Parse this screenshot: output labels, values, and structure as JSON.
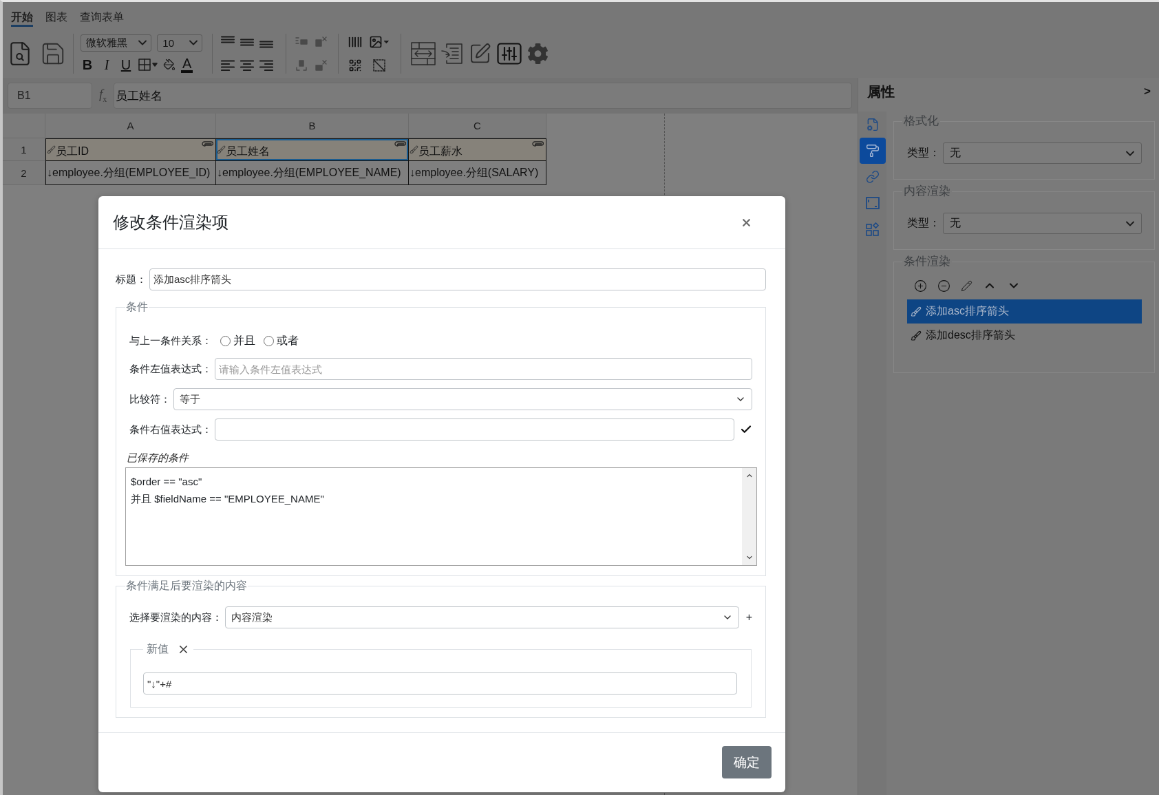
{
  "menu_tabs": [
    {
      "label": "开始",
      "selected": true
    },
    {
      "label": "图表",
      "selected": false
    },
    {
      "label": "查询表单",
      "selected": false
    }
  ],
  "toolbar": {
    "font_family": "微软雅黑",
    "font_size": "10",
    "style_buttons": [
      {
        "kind": "bold",
        "label": "B"
      },
      {
        "kind": "italic",
        "label": "I"
      },
      {
        "kind": "underline",
        "label": "U"
      }
    ],
    "font_color": {
      "label": "A"
    }
  },
  "formula_bar": {
    "cell_ref": "B1",
    "fx": "f$_{x}$",
    "value": "员工姓名"
  },
  "sheet": {
    "columns": [
      "A",
      "B",
      "C"
    ],
    "rows": [
      {
        "number": "1",
        "kind": "header",
        "cells": [
          {
            "text": "员工ID",
            "selected": false
          },
          {
            "text": "员工姓名",
            "selected": true
          },
          {
            "text": "员工薪水",
            "selected": false
          }
        ]
      },
      {
        "number": "2",
        "kind": "data",
        "cells": [
          {
            "text": "↓employee.分组(EMPLOYEE_ID)",
            "selected": false
          },
          {
            "text": "↓employee.分组(EMPLOYEE_NAME)",
            "selected": false
          },
          {
            "text": "↓employee.分组(SALARY)",
            "selected": false
          }
        ]
      }
    ]
  },
  "properties": {
    "title": "属性",
    "toggle": ">",
    "side_tabs": [
      {
        "selected": false
      },
      {
        "selected": true
      },
      {
        "selected": false
      },
      {
        "selected": false
      },
      {
        "selected": false
      }
    ],
    "sections": [
      {
        "kind": "select",
        "legend": "格式化",
        "label": "类型：",
        "value": "无"
      },
      {
        "kind": "select",
        "legend": "内容渲染",
        "label": "类型：",
        "value": "无"
      },
      {
        "kind": "list",
        "legend": "条件渲染",
        "items": [
          {
            "label": "添加asc排序箭头",
            "selected": true
          },
          {
            "label": "添加desc排序箭头",
            "selected": false
          }
        ]
      }
    ]
  },
  "dialog": {
    "title": "修改条件渲染项",
    "title_field": {
      "label": "标题：",
      "value": "添加asc排序箭头"
    },
    "condition": {
      "legend": "条件",
      "relation": {
        "label": "与上一条件关系：",
        "options": [
          {
            "label": "并且",
            "selected": false
          },
          {
            "label": "或者",
            "selected": false
          }
        ]
      },
      "left": {
        "label": "条件左值表达式：",
        "placeholder": "请输入条件左值表达式"
      },
      "comparator": {
        "label": "比较符：",
        "value": "等于"
      },
      "right": {
        "label": "条件右值表达式："
      },
      "saved_label": "已保存的条件",
      "saved_lines": [
        "$order == \"asc\"",
        "并且 $fieldName == \"EMPLOYEE_NAME\""
      ]
    },
    "render": {
      "legend": "条件满足后要渲染的内容",
      "content_select": {
        "label": "选择要渲染的内容：",
        "value": "内容渲染"
      },
      "add_symbol": "+",
      "new_value": {
        "legend": "新值",
        "value": "\"↓\"+#"
      }
    },
    "confirm": "确定"
  }
}
